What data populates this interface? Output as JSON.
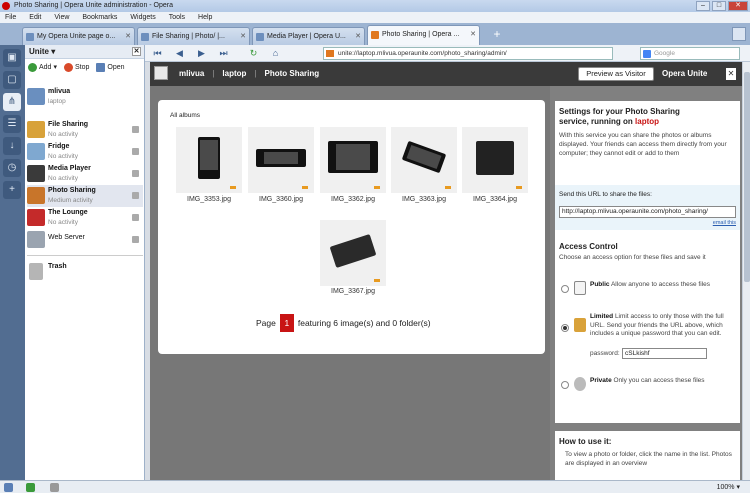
{
  "window": {
    "title": "Photo Sharing | Opera Unite administration - Opera"
  },
  "menu": [
    "File",
    "Edit",
    "View",
    "Bookmarks",
    "Widgets",
    "Tools",
    "Help"
  ],
  "tabs": [
    {
      "label": "My Opera Unite page o..."
    },
    {
      "label": "File Sharing | Photo/ |..."
    },
    {
      "label": "Media Player | Opera U..."
    },
    {
      "label": "Photo Sharing | Opera ..."
    }
  ],
  "panel": {
    "title": "Unite",
    "add": "Add",
    "stop": "Stop",
    "open": "Open",
    "user": {
      "name": "mlivua",
      "device": "laptop"
    },
    "services": [
      {
        "name": "File Sharing",
        "status": "No activity",
        "color": "#d8a23a"
      },
      {
        "name": "Fridge",
        "status": "No activity",
        "color": "#7fa8d0"
      },
      {
        "name": "Media Player",
        "status": "No activity",
        "color": "#3a3a3a"
      },
      {
        "name": "Photo Sharing",
        "status": "Medium activity",
        "color": "#c8752a"
      },
      {
        "name": "The Lounge",
        "status": "No activity",
        "color": "#c42a2a"
      },
      {
        "name": "Web Server",
        "status": "",
        "color": "#9aa4b0"
      }
    ],
    "trash": "Trash"
  },
  "address": {
    "url": "unite://laptop.mlivua.operaunite.com/photo_sharing/admin/",
    "search_placeholder": "Google"
  },
  "site": {
    "user": "mlivua",
    "device": "laptop",
    "service": "Photo Sharing",
    "preview": "Preview as Visitor",
    "brand": "Opera Unite"
  },
  "gallery": {
    "heading": "All albums",
    "photos": [
      {
        "name": "IMG_3353.jpg"
      },
      {
        "name": "IMG_3360.jpg"
      },
      {
        "name": "IMG_3362.jpg"
      },
      {
        "name": "IMG_3363.jpg"
      },
      {
        "name": "IMG_3364.jpg"
      },
      {
        "name": "IMG_3367.jpg"
      }
    ],
    "page_label": "Page",
    "page_number": "1",
    "featuring": "featuring 6 image(s) and 0 folder(s)"
  },
  "settings": {
    "title_line1": "Settings for your Photo Sharing",
    "title_line2": "service, running on",
    "device": "laptop",
    "intro": "With this service you can share the photos or albums displayed. Your friends can access them directly from your computer; they cannot edit or add to them",
    "send_label": "Send this URL to share the files:",
    "share_url": "http://laptop.mlivua.operaunite.com/photo_sharing/",
    "email_link": "email this",
    "access_title": "Access Control",
    "access_desc": "Choose an access option for these files and save it",
    "public_label": "Public",
    "public_text": "Allow anyone to access these files",
    "limited_label": "Limited",
    "limited_text": "Limit access to only those with the full URL. Send your friends the URL above, which includes a unique password that you can edit.",
    "password_label": "password:",
    "password": "cSLkishf",
    "private_label": "Private",
    "private_text": "Only you can access these files"
  },
  "howto": {
    "title": "How to use it:",
    "text": "To view a photo or folder, click the name in the list. Photos are displayed in an overview"
  },
  "status": {
    "zoom": "100%"
  }
}
